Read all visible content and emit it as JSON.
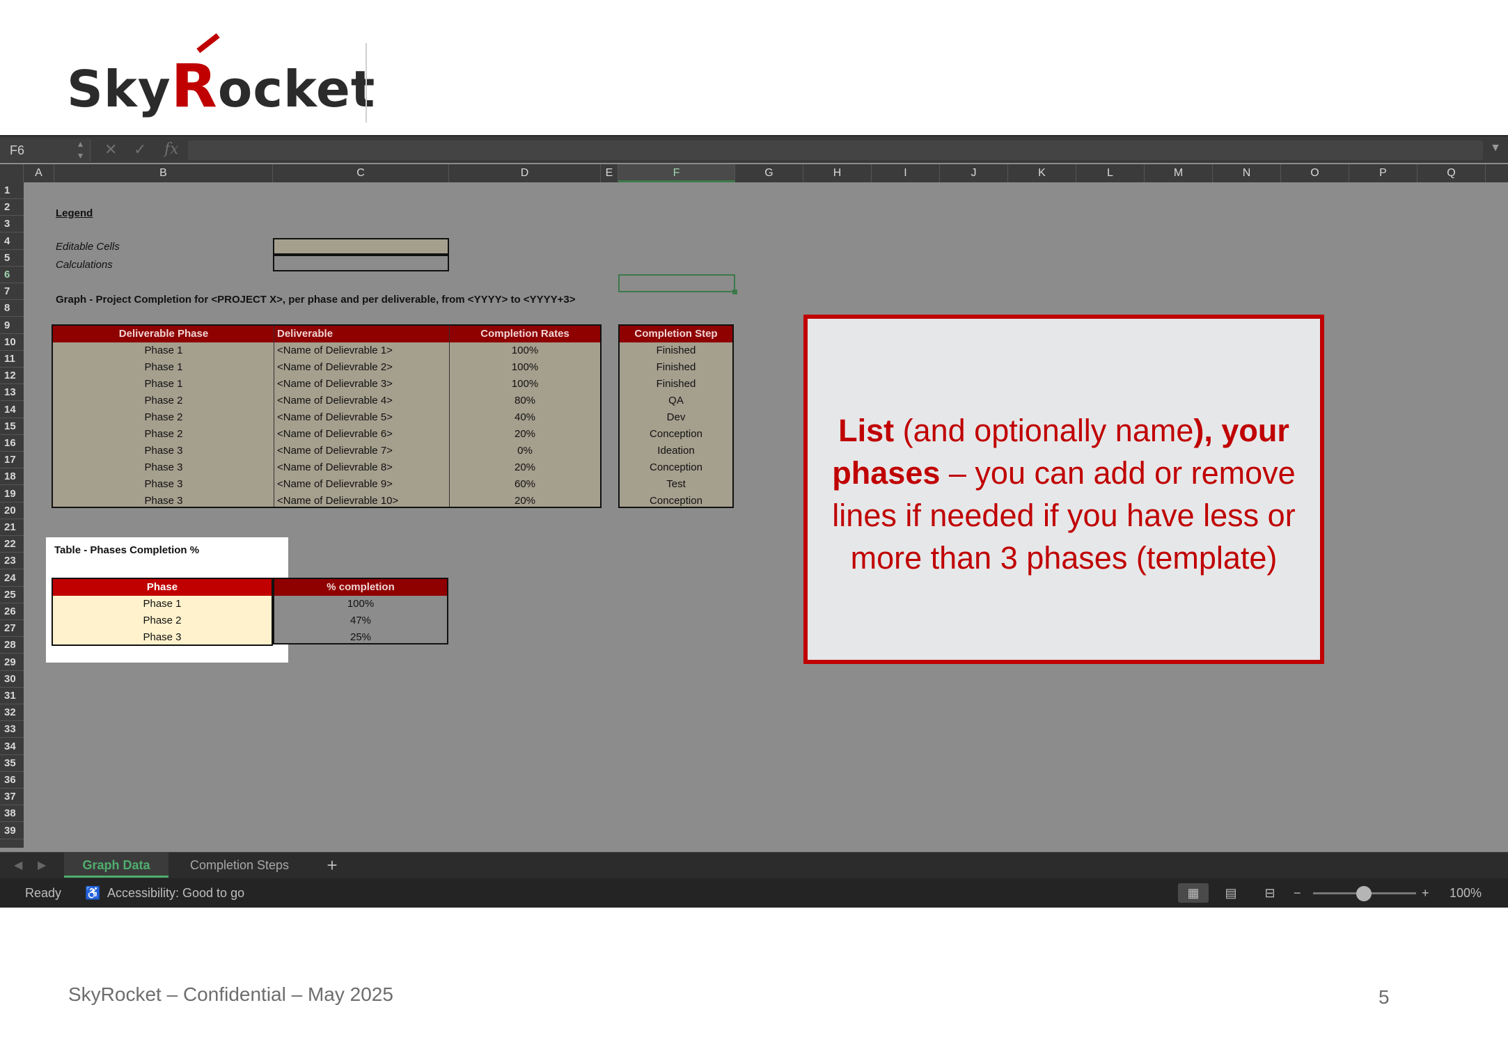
{
  "logo": {
    "text_pre": "Sky",
    "text_r": "R",
    "text_post": "ocket"
  },
  "excel": {
    "name_box": "F6",
    "columns": [
      "A",
      "B",
      "C",
      "D",
      "E",
      "F",
      "G",
      "H",
      "I",
      "J",
      "K",
      "L",
      "M",
      "N",
      "O",
      "P",
      "Q"
    ],
    "rows": [
      "1",
      "2",
      "3",
      "4",
      "5",
      "6",
      "7",
      "8",
      "9",
      "10",
      "11",
      "12",
      "13",
      "14",
      "15",
      "16",
      "17",
      "18",
      "19",
      "20",
      "21",
      "22",
      "23",
      "24",
      "25",
      "26",
      "27",
      "28",
      "29",
      "30",
      "31",
      "32",
      "33",
      "34",
      "35",
      "36",
      "37",
      "38",
      "39"
    ],
    "legend": {
      "title": "Legend",
      "editable": "Editable Cells",
      "calculations": "Calculations"
    },
    "graph_title": "Graph - Project Completion for <PROJECT X>, per phase and per deliverable, from <YYYY> to <YYYY+3>",
    "deliverables_table": {
      "headers": [
        "Deliverable Phase",
        "Deliverable",
        "Completion Rates"
      ],
      "rows": [
        [
          "Phase 1",
          "<Name of Delievrable 1>",
          "100%"
        ],
        [
          "Phase 1",
          "<Name of Delievrable 2>",
          "100%"
        ],
        [
          "Phase 1",
          "<Name of Delievrable 3>",
          "100%"
        ],
        [
          "Phase 2",
          "<Name of Delievrable 4>",
          "80%"
        ],
        [
          "Phase 2",
          "<Name of Delievrable 5>",
          "40%"
        ],
        [
          "Phase 2",
          "<Name of Delievrable 6>",
          "20%"
        ],
        [
          "Phase 3",
          "<Name of Delievrable 7>",
          "0%"
        ],
        [
          "Phase 3",
          "<Name of Delievrable 8>",
          "20%"
        ],
        [
          "Phase 3",
          "<Name of Delievrable 9>",
          "60%"
        ],
        [
          "Phase 3",
          "<Name of Delievrable 10>",
          "20%"
        ]
      ]
    },
    "steps_table": {
      "header": "Completion Step",
      "rows": [
        "Finished",
        "Finished",
        "Finished",
        "QA",
        "Dev",
        "Conception",
        "Ideation",
        "Conception",
        "Test",
        "Conception"
      ]
    },
    "phases_table": {
      "title": "Table - Phases Completion %",
      "headers": [
        "Phase",
        "% completion"
      ],
      "rows": [
        [
          "Phase 1",
          "100%"
        ],
        [
          "Phase 2",
          "47%"
        ],
        [
          "Phase 3",
          "25%"
        ]
      ]
    },
    "sheet_tabs": [
      "Graph Data",
      "Completion Steps"
    ],
    "add_sheet": "+",
    "status": {
      "ready": "Ready",
      "accessibility": "Accessibility: Good to go",
      "zoom": "100%",
      "zoom_minus": "−",
      "zoom_plus": "+"
    },
    "colors": {
      "header_red": "#8f0000",
      "editable_tan": "#a59f8e",
      "phase_fill": "#fff2cc",
      "selection_green": "#3c7a4a"
    }
  },
  "callout": {
    "t1": "List",
    "t2": " (and optionally name",
    "t3": "), your phases",
    "t4": " – you can add or remove lines if needed if you have less or more than 3 phases (template)"
  },
  "footer": {
    "left": "SkyRocket – Confidential – May 2025",
    "page": "5"
  }
}
